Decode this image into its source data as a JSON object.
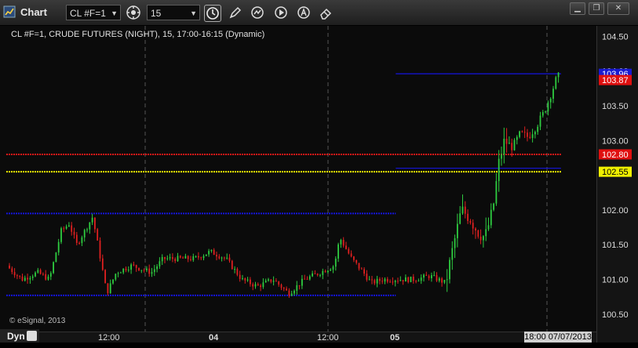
{
  "window": {
    "title": "Chart"
  },
  "toolbar": {
    "symbol": "CL #F=1",
    "interval": "15",
    "buttons": [
      "settings-icon",
      "clock-icon",
      "pencil-icon",
      "cursor-icon",
      "play-icon",
      "text-annotation-icon",
      "eraser-icon"
    ]
  },
  "window_controls": [
    "minimize",
    "restore",
    "close"
  ],
  "chart": {
    "info_line": "CL #F=1, CRUDE FUTURES (NIGHT), 15, 17:00-16:15 (Dynamic)",
    "copyright": "© eSignal, 2013",
    "dyn_label": "Dyn",
    "current_time": "18:00 07/07/2013"
  },
  "chart_data": {
    "type": "candlestick",
    "y_ticks": [
      "104.50",
      "104.00",
      "103.50",
      "103.00",
      "102.00",
      "101.50",
      "101.00",
      "100.50"
    ],
    "x_ticks": [
      "12:00",
      "04",
      "12:00",
      "05"
    ],
    "ylim": [
      100.25,
      104.65
    ],
    "price_tags": [
      {
        "label": "103.96",
        "color": "#1a1ad0",
        "text": "#ffffff"
      },
      {
        "label": "103.87",
        "color": "#e01010",
        "text": "#ffffff"
      },
      {
        "label": "102.80",
        "color": "#e01010",
        "text": "#ffffff"
      },
      {
        "label": "102.55",
        "color": "#f0f000",
        "text": "#000000"
      }
    ],
    "levels": [
      {
        "price": 103.96,
        "color": "#1515e0",
        "style": "solid",
        "x_from": 0.66,
        "x_to": 0.94
      },
      {
        "price": 102.8,
        "color": "#e01818",
        "style": "dotted",
        "x_from": 0,
        "x_to": 0.94
      },
      {
        "price": 102.55,
        "color": "#f0f000",
        "style": "dotted",
        "x_from": 0,
        "x_to": 0.94
      },
      {
        "price": 102.6,
        "color": "#1515e0",
        "style": "solid",
        "x_from": 0.66,
        "x_to": 0.94
      },
      {
        "price": 101.95,
        "color": "#1515e0",
        "style": "dotted",
        "x_from": 0,
        "x_to": 0.66
      },
      {
        "price": 100.77,
        "color": "#1515e0",
        "style": "dotted",
        "x_from": 0,
        "x_to": 0.66
      }
    ],
    "colors": {
      "up": "#2ecc40",
      "down": "#e02020",
      "background": "#0b0b0b"
    }
  }
}
